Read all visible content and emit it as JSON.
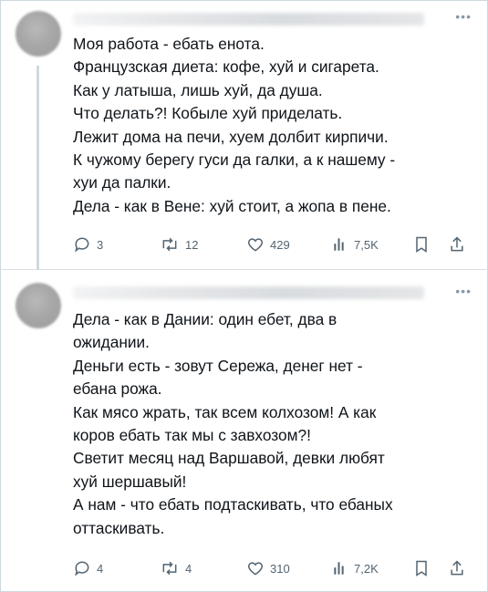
{
  "tweets": [
    {
      "lines": [
        "Моя работа - ебать енота.",
        "Французская диета: кофе, хуй и сигарета.",
        "Как у латыша, лишь хуй, да душа.",
        "Что делать?! Кобыле хуй приделать.",
        "Лежит дома на печи, хуем долбит кирпичи.",
        "К чужому берегу гуси да галки, а к нашему -",
        "хуи да палки.",
        "Дела - как в Вене: хуй стоит, а жопа в пене."
      ],
      "actions": {
        "replies": "3",
        "reposts": "12",
        "likes": "429",
        "views": "7,5K"
      }
    },
    {
      "lines": [
        "Дела - как в Дании: один ебет, два в",
        "ожидании.",
        "Деньги есть - зовут Сережа, денег нет -",
        "ебана рожа.",
        "Как мясо жрать, так всем колхозом! А как",
        "коров ебать так мы с завхозом?!",
        "Светит месяц над Варшавой, девки любят",
        "хуй шершавый!",
        "А нам - что ебать подтаскивать, что ебаных",
        "оттаскивать."
      ],
      "actions": {
        "replies": "4",
        "reposts": "4",
        "likes": "310",
        "views": "7,2K"
      }
    }
  ],
  "icons": {
    "more": "more-dots-icon",
    "reply": "reply-icon",
    "repost": "repost-icon",
    "like": "like-icon",
    "views": "views-icon",
    "bookmark": "bookmark-icon",
    "share": "share-icon"
  },
  "colors": {
    "icon_gray": "#536471",
    "text": "#0f1419",
    "divider": "#cfd9de"
  }
}
